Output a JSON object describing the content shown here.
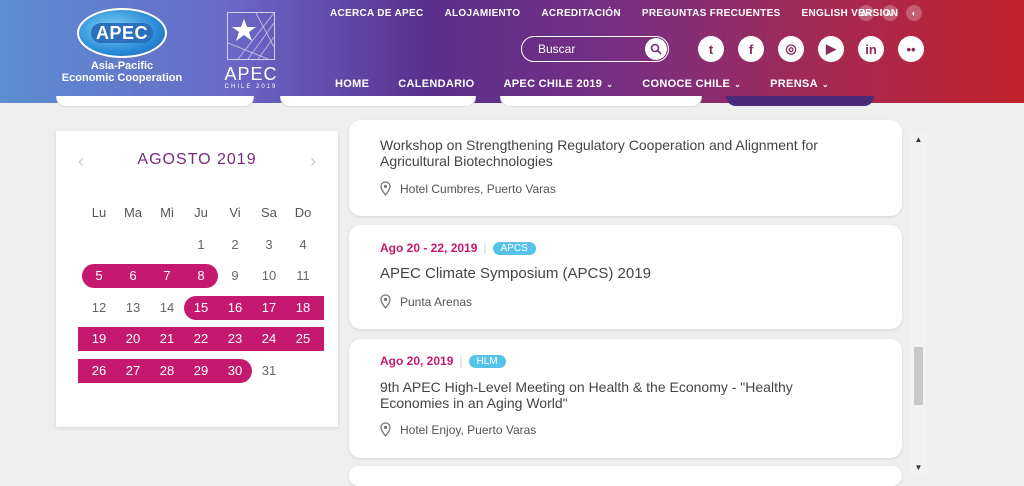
{
  "header": {
    "apec_logo_word": "APEC",
    "apec_logo_sub1": "Asia-Pacific",
    "apec_logo_sub2": "Economic Cooperation",
    "chile_logo_word": "APEC",
    "chile_logo_small": "CHILE 2019"
  },
  "top_nav": [
    "ACERCA DE APEC",
    "ALOJAMIENTO",
    "ACREDITACIÓN",
    "PREGUNTAS FRECUENTES",
    "ENGLISH VERSION"
  ],
  "a11y": {
    "increase": "A+",
    "decrease": "A-",
    "contrast": "◐"
  },
  "search": {
    "placeholder": "Buscar"
  },
  "social": [
    {
      "name": "twitter-icon",
      "glyph": "t"
    },
    {
      "name": "facebook-icon",
      "glyph": "f"
    },
    {
      "name": "instagram-icon",
      "glyph": "◎"
    },
    {
      "name": "youtube-icon",
      "glyph": "▶"
    },
    {
      "name": "linkedin-icon",
      "glyph": "in"
    },
    {
      "name": "flickr-icon",
      "glyph": "••"
    }
  ],
  "main_nav": [
    {
      "label": "HOME",
      "dropdown": false
    },
    {
      "label": "CALENDARIO",
      "dropdown": false
    },
    {
      "label": "APEC CHILE 2019",
      "dropdown": true
    },
    {
      "label": "CONOCE CHILE",
      "dropdown": true
    },
    {
      "label": "PRENSA",
      "dropdown": true
    }
  ],
  "calendar": {
    "month": "AGOSTO 2019",
    "weekdays": [
      "Lu",
      "Ma",
      "Mi",
      "Ju",
      "Vi",
      "Sa",
      "Do"
    ],
    "weeks": [
      [
        "",
        "",
        "",
        "1",
        "2",
        "3",
        "4"
      ],
      [
        "5",
        "6",
        "7",
        "8",
        "9",
        "10",
        "11"
      ],
      [
        "12",
        "13",
        "14",
        "15",
        "16",
        "17",
        "18"
      ],
      [
        "19",
        "20",
        "21",
        "22",
        "23",
        "24",
        "25"
      ],
      [
        "26",
        "27",
        "28",
        "29",
        "30",
        "31",
        ""
      ]
    ],
    "highlighted": [
      "5",
      "6",
      "7",
      "8",
      "15",
      "16",
      "17",
      "18",
      "19",
      "20",
      "21",
      "22",
      "23",
      "24",
      "25",
      "26",
      "27",
      "28",
      "29",
      "30"
    ],
    "colors": {
      "highlight": "#c4196f",
      "month": "#7a2a7e"
    }
  },
  "events": [
    {
      "date": "",
      "badge": "",
      "title": "Workshop on Strengthening Regulatory Cooperation and Alignment for Agricultural Biotechnologies",
      "location": "Hotel Cumbres, Puerto Varas"
    },
    {
      "date": "Ago 20 - 22, 2019",
      "badge": "APCS",
      "title": "APEC Climate Symposium (APCS) 2019",
      "location": "Punta Arenas"
    },
    {
      "date": "Ago 20, 2019",
      "badge": "HLM",
      "title": "9th APEC High-Level Meeting on Health & the Economy - \"Healthy Economies in an Aging World\"",
      "location": "Hotel Enjoy, Puerto Varas"
    }
  ],
  "colors": {
    "badge": "#57c3e8",
    "date": "#c4196f"
  }
}
